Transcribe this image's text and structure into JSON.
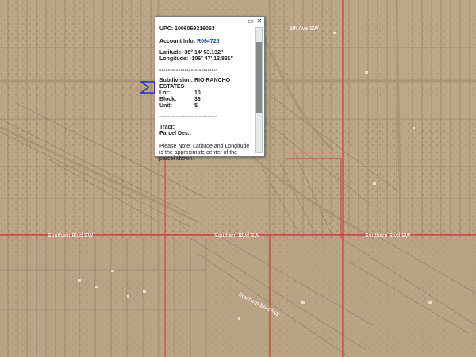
{
  "popup": {
    "upc_label": "UPC:",
    "upc_value": "1006069319053",
    "account_label": "Account Info:",
    "account_value": "R064725",
    "latitude_label": "Latitude:",
    "latitude_value": "35° 14' 53.132\"",
    "longitude_label": "Longitude:",
    "longitude_value": "-106° 47' 13.831\"",
    "separator": "----------------------------",
    "subdivision_label": "Subdivision:",
    "subdivision_value": "RIO RANCHO ESTATES",
    "lot_label": "Lot:",
    "lot_value": "10",
    "block_label": "Block:",
    "block_value": "33",
    "unit_label": "Unit:",
    "unit_value": "5",
    "tract_label": "Tract:",
    "parcel_label": "Parcel Des.:",
    "note": "Please Note: Latitude and Longitude is the approximate center of the parcel shown.",
    "maximize_icon": "maximize-icon",
    "close_icon": "close-icon"
  },
  "roads": [
    {
      "label": "Southern Blvd SW"
    },
    {
      "label": "Southern Blvd SW"
    },
    {
      "label": "Southern Blvd SW"
    },
    {
      "label": "8th Ave SW"
    },
    {
      "label": "Southern Blvd SW"
    }
  ],
  "colors": {
    "terrain": "#b9a487",
    "parcel_line": "#7a6a55",
    "major_boundary": "#d23a3a",
    "selected_parcel": "#2a2ad8"
  }
}
